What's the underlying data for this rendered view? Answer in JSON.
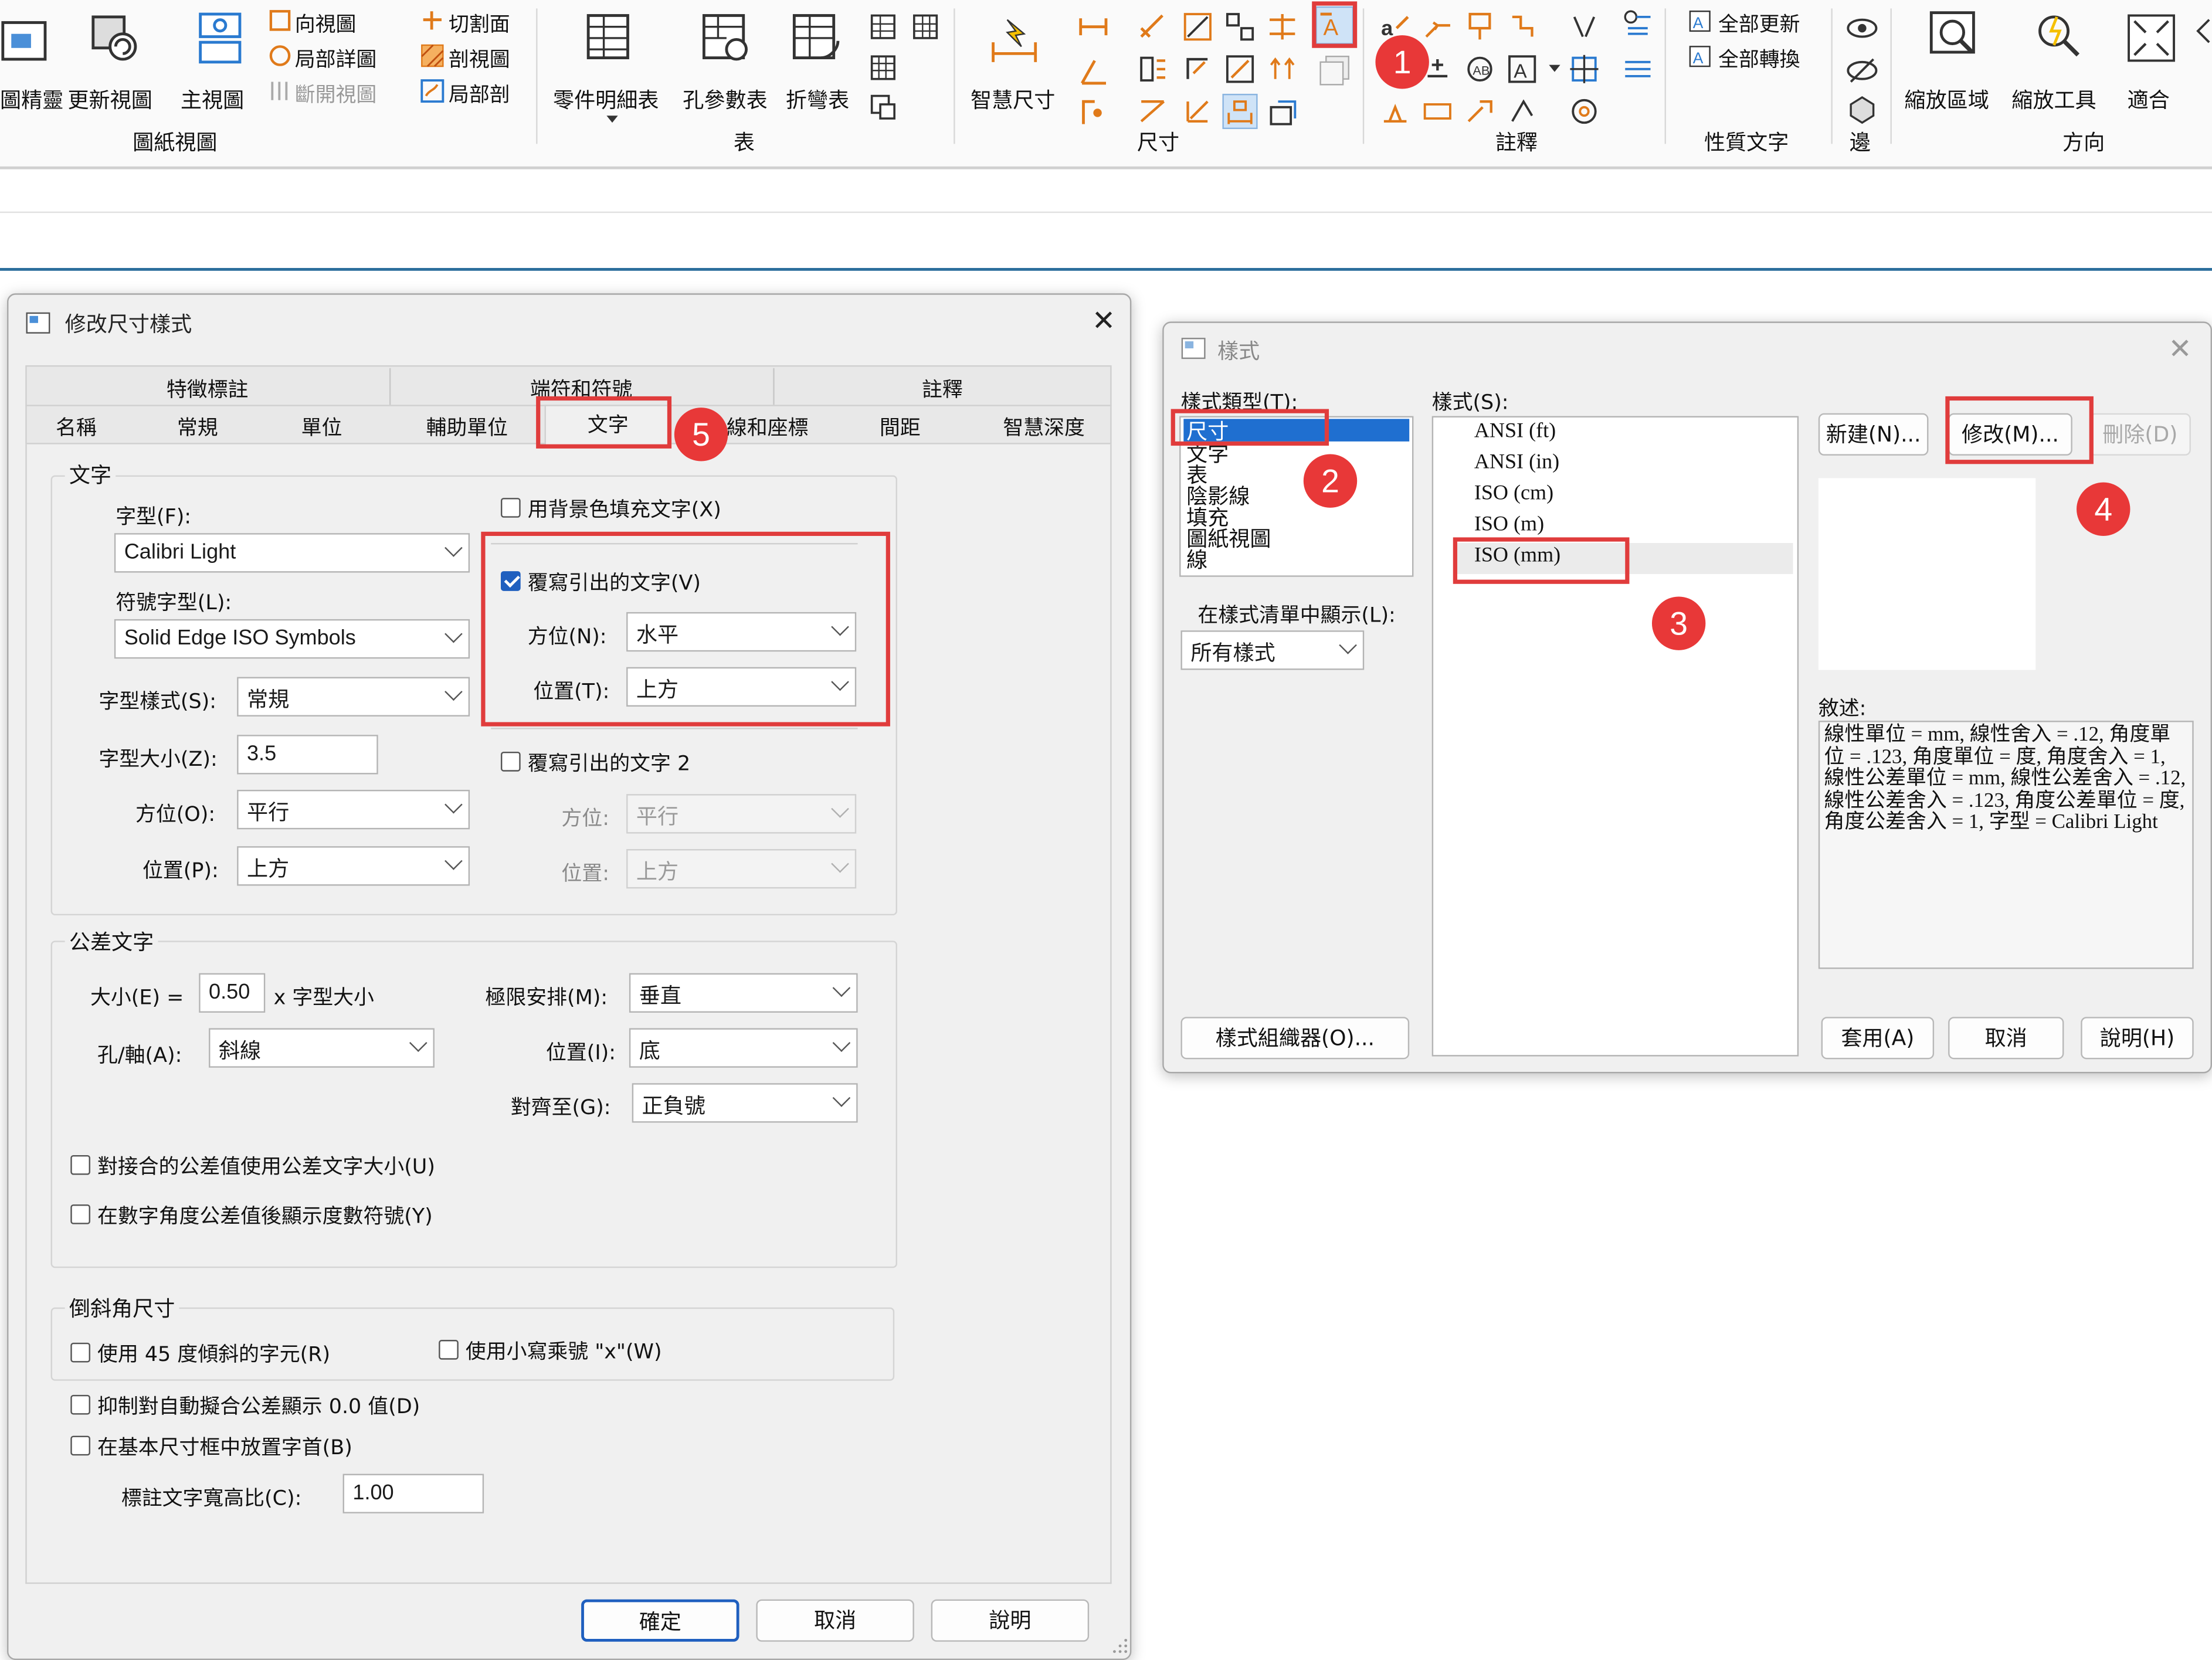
{
  "ribbon": {
    "drawing_views_group": {
      "label": "圖紙視圖",
      "buttons": [
        "圖精靈",
        "更新視圖",
        "主視圖"
      ],
      "small": [
        "向視圖",
        "局部詳圖",
        "斷開視圖"
      ],
      "small2": [
        "切割面",
        "剖視圖",
        "局部剖"
      ]
    },
    "tables_group": {
      "label": "表",
      "buttons": [
        "零件明細表",
        "孔參數表",
        "折彎表"
      ]
    },
    "dimension_group": {
      "label": "尺寸",
      "smart_dim": "智慧尺寸"
    },
    "annotation_group": {
      "label": "註釋"
    },
    "property_text_group": {
      "label": "性質文字",
      "update_all": "全部更新",
      "convert_all": "全部轉換"
    },
    "edges_group": {
      "label": "邊"
    },
    "orientation_group": {
      "label": "方向",
      "zoom_area": "縮放區域",
      "zoom_tool": "縮放工具",
      "fit": "適合"
    }
  },
  "modify_dialog": {
    "title": "修改尺寸樣式",
    "tabs_row1": [
      "特徵標註",
      "端符和符號",
      "註釋"
    ],
    "tabs_row2": [
      "名稱",
      "常規",
      "單位",
      "輔助單位",
      "文字",
      "線和座標",
      "間距",
      "智慧深度"
    ],
    "text_group": {
      "title": "文字",
      "font_label": "字型(F):",
      "font_value": "Calibri Light",
      "symbol_font_label": "符號字型(L):",
      "symbol_font_value": "Solid Edge ISO Symbols",
      "font_style_label": "字型樣式(S):",
      "font_style_value": "常規",
      "font_size_label": "字型大小(Z):",
      "font_size_value": "3.5",
      "orientation_label": "方位(O):",
      "orientation_value": "平行",
      "position_label": "位置(P):",
      "position_value": "上方",
      "fill_bg_label": "用背景色填充文字(X)",
      "override_label": "覆寫引出的文字(V)",
      "override_orient_label": "方位(N):",
      "override_orient_value": "水平",
      "override_pos_label": "位置(T):",
      "override_pos_value": "上方",
      "override2_label": "覆寫引出的文字 2",
      "override2_orient_label": "方位:",
      "override2_orient_value": "平行",
      "override2_pos_label": "位置:",
      "override2_pos_value": "上方"
    },
    "tolerance_group": {
      "title": "公差文字",
      "size_label": "大小(E) =",
      "size_value": "0.50",
      "size_suffix": "x 字型大小",
      "hole_label": "孔/軸(A):",
      "hole_value": "斜線",
      "limit_label": "極限安排(M):",
      "limit_value": "垂直",
      "pos_label": "位置(I):",
      "pos_value": "底",
      "align_label": "對齊至(G):",
      "align_value": "正負號",
      "chk1": "對接合的公差值使用公差文字大小(U)",
      "chk2": "在數字角度公差值後顯示度數符號(Y)"
    },
    "chamfer_group": {
      "title": "倒斜角尺寸",
      "chk1": "使用 45 度傾斜的字元(R)",
      "chk2": "使用小寫乘號 \"x\"(W)"
    },
    "chk_suppress": "抑制對自動擬合公差顯示 0.0 值(D)",
    "chk_basic": "在基本尺寸框中放置字首(B)",
    "aspect_label": "標註文字寬高比(C):",
    "aspect_value": "1.00",
    "ok": "確定",
    "cancel": "取消",
    "help": "說明"
  },
  "style_dialog": {
    "title": "樣式",
    "type_label": "樣式類型(T):",
    "types": [
      "尺寸",
      "文字",
      "表",
      "陰影線",
      "填充",
      "圖紙視圖",
      "線"
    ],
    "styles_label": "樣式(S):",
    "styles": [
      "ANSI (ft)",
      "ANSI (in)",
      "ISO (cm)",
      "ISO (m)",
      "ISO (mm)"
    ],
    "show_label": "在樣式清單中顯示(L):",
    "show_value": "所有樣式",
    "new": "新建(N)...",
    "modify": "修改(M)...",
    "delete": "刪除(D)",
    "desc_label": "敘述:",
    "desc_text": "線性單位 = mm, 線性舍入 = .12, 角度單位 = .123, 角度單位 = 度, 角度舍入 = 1, 線性公差單位 = mm, 線性公差舍入 = .12, 線性公差舍入 = .123, 角度公差單位 = 度, 角度公差舍入 = 1, 字型 = Calibri Light",
    "organizer": "樣式組織器(O)...",
    "apply": "套用(A)",
    "cancel": "取消",
    "help": "說明(H)"
  },
  "callouts": [
    "1",
    "2",
    "3",
    "4",
    "5"
  ],
  "colors": {
    "callout": "#e83838",
    "accent": "#1f5fbf"
  }
}
